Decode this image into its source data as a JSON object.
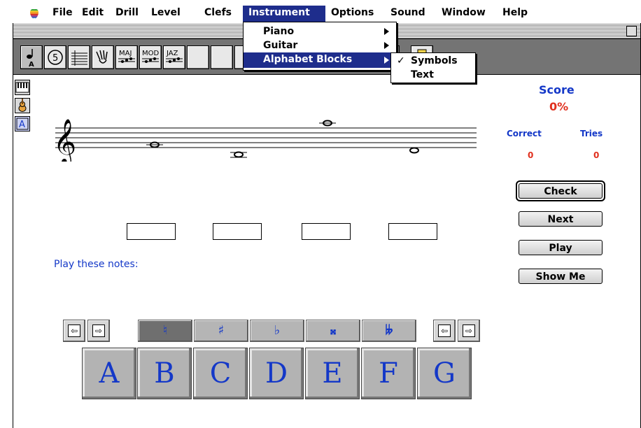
{
  "menubar": {
    "items": [
      "File",
      "Edit",
      "Drill",
      "Level",
      "Clefs",
      "Instrument",
      "Options",
      "Sound",
      "Window",
      "Help"
    ]
  },
  "toolbar": {
    "tools": [
      "note-name",
      "fifths",
      "key-signature",
      "hand-signs",
      "MAJ",
      "MOD",
      "JAZ"
    ],
    "labels": {
      "fifths": "5",
      "maj": "MAJ",
      "mod": "MOD",
      "jaz": "JAZ",
      "note_letter": "A"
    }
  },
  "sidebar": {
    "icons": [
      "piano-icon",
      "guitar-icon",
      "alphabet-block-icon"
    ],
    "block_letter": "A"
  },
  "instrument_menu": {
    "items": [
      {
        "label": "Piano",
        "submenu": true
      },
      {
        "label": "Guitar",
        "submenu": true
      },
      {
        "label": "Alphabet Blocks",
        "submenu": true,
        "highlighted": true
      }
    ],
    "submenu": [
      {
        "label": "Symbols",
        "checked": true,
        "check": "✓"
      },
      {
        "label": "Text",
        "checked": false
      }
    ]
  },
  "score": {
    "title": "Score",
    "percent": "0%",
    "correct_label": "Correct",
    "tries_label": "Tries",
    "correct": "0",
    "tries": "0"
  },
  "buttons": {
    "check": "Check",
    "next": "Next",
    "play": "Play",
    "show_me": "Show Me"
  },
  "prompt": "Play these notes:",
  "staff": {
    "clef": "treble",
    "note_count": 4
  },
  "accidentals": {
    "items": [
      "♮",
      "♯",
      "♭",
      "𝄪",
      "𝄫"
    ],
    "selected": 0
  },
  "letters": [
    "A",
    "B",
    "C",
    "D",
    "E",
    "F",
    "G"
  ]
}
